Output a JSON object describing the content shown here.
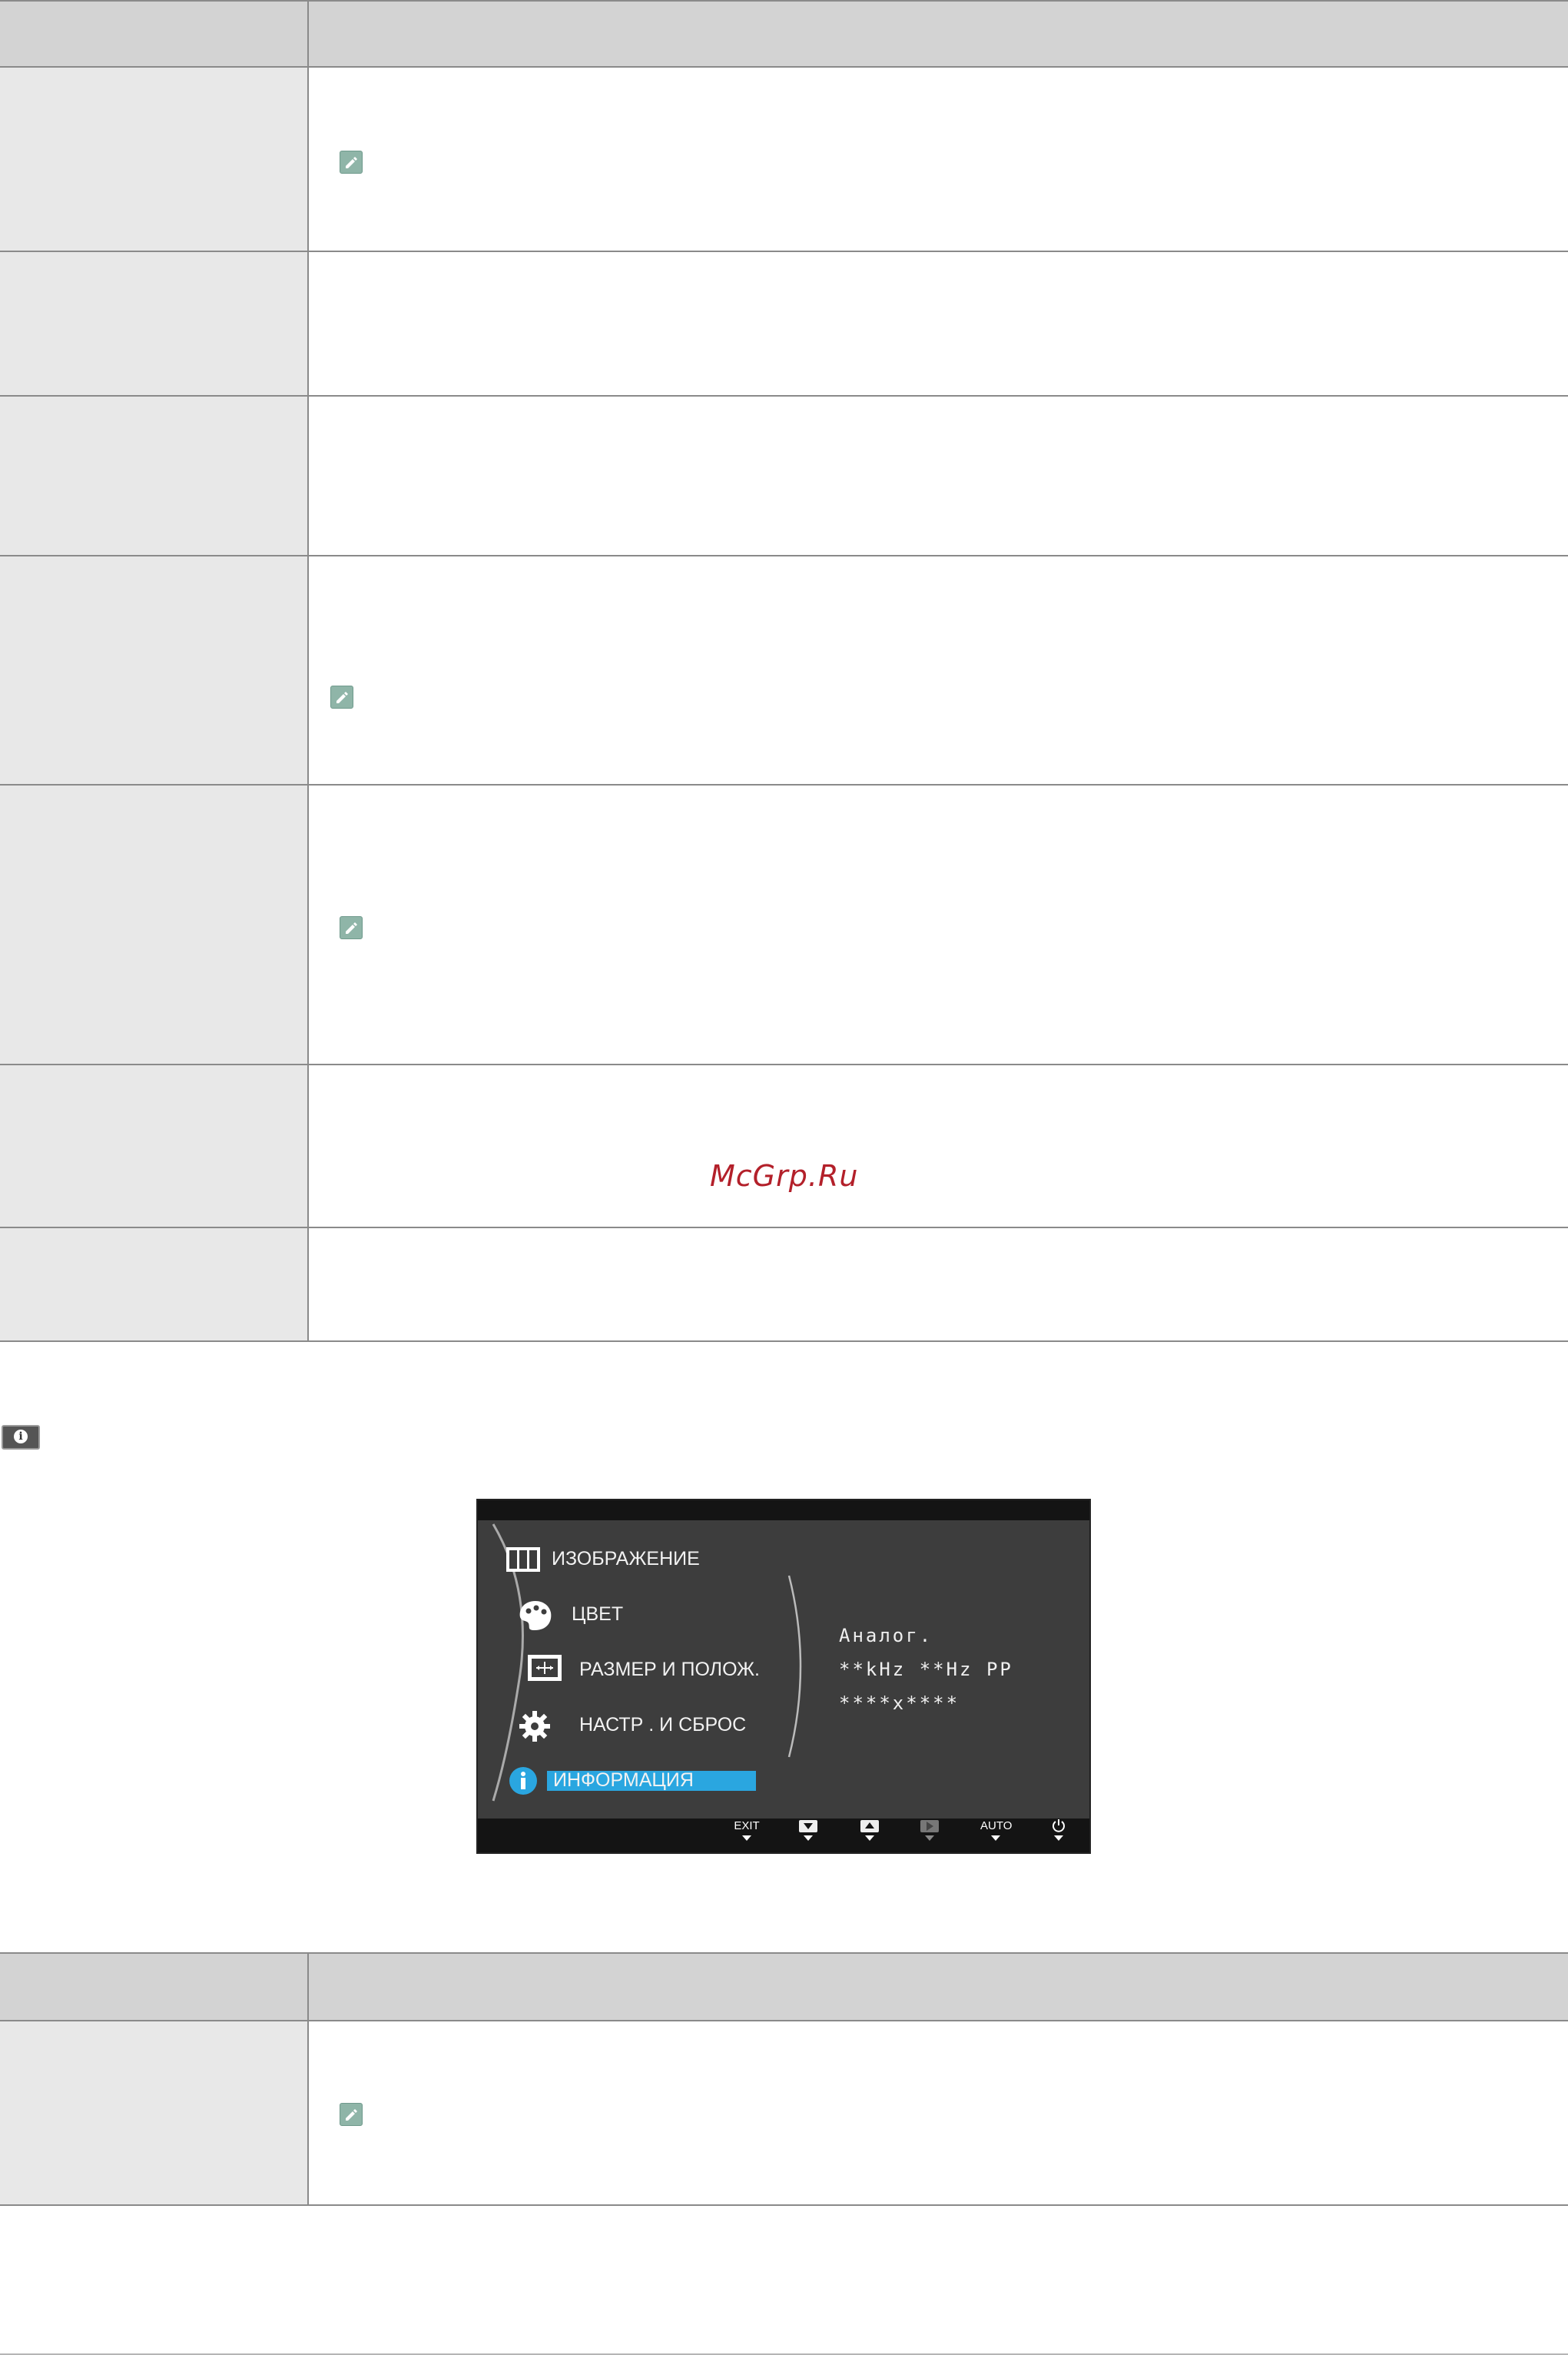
{
  "watermark": "McGrp.Ru",
  "osd": {
    "menu_items": [
      {
        "label": "ИЗОБРАЖЕНИЕ",
        "icon": "picture-icon"
      },
      {
        "label": "ЦВЕТ",
        "icon": "palette-icon"
      },
      {
        "label": "РАЗМЕР И ПОЛОЖ.",
        "icon": "size-position-icon"
      },
      {
        "label": "НАСТР . И СБРОС",
        "icon": "gear-icon"
      },
      {
        "label": "ИНФОРМАЦИЯ",
        "icon": "info-icon",
        "selected": true
      }
    ],
    "info_values": [
      "Аналог.",
      "**kHz **Hz PP",
      "****x****"
    ],
    "buttons": [
      {
        "label": "EXIT",
        "name": "exit-button"
      },
      {
        "label": "",
        "name": "down-button"
      },
      {
        "label": "",
        "name": "up-button"
      },
      {
        "label": "",
        "name": "enter-button",
        "dim": true
      },
      {
        "label": "AUTO",
        "name": "auto-button"
      },
      {
        "label": "",
        "name": "power-button"
      }
    ],
    "accent_color": "#2aa6e0",
    "background_color": "#3d3d3d"
  }
}
